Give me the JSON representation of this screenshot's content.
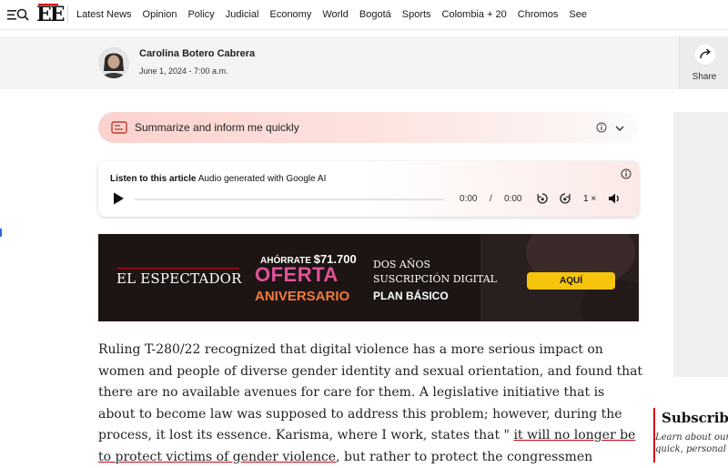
{
  "nav": {
    "logo": "EE",
    "links": [
      "Latest News",
      "Opinion",
      "Policy",
      "Judicial",
      "Economy",
      "World",
      "Bogotá",
      "Sports",
      "Colombia + 20",
      "Chromos",
      "See"
    ]
  },
  "author": {
    "name": "Carolina Botero Cabrera",
    "date": "June 1, 2024 - 7:00 a.m.",
    "share_label": "Share"
  },
  "summarize": {
    "label": "Summarize and inform me quickly"
  },
  "audio": {
    "title": "Listen to this article",
    "subtitle": "Audio generated with Google AI",
    "current_time": "0:00",
    "separator": "/",
    "total_time": "0:00",
    "speed": "1 ×"
  },
  "ad": {
    "brand": "EL ESPECTADOR",
    "save_prefix": "AHÓRRATE",
    "save_amount": "$71.700",
    "offer_line1": "OFERTA",
    "offer_line2": "ANIVERSARIO",
    "right_line1": "DOS AÑOS",
    "right_line2": "SUSCRIPCIÓN DIGITAL",
    "right_line3": "PLAN BÁSICO",
    "cta": "AQUÍ"
  },
  "article": {
    "text_before_quote": "Ruling T-280/22 recognized that digital violence has a more serious impact on women and people of diverse gender identity and sexual orientation, and found that there are no available avenues for care for them. A legislative initiative that is about to become law was supposed to address this problem; however, during the process, it lost its essence. Karisma, where I work, states that \" ",
    "quote": "it will no longer be to protect victims of gender violence",
    "text_after_quote": ", but rather to protect the congressmen"
  },
  "subscribe": {
    "title": "Subscribe",
    "desc_line1": "Learn about our",
    "desc_line2": "quick, personal"
  },
  "colors": {
    "brand_red": "#d6001c",
    "cta_yellow": "#f6c40c",
    "offer_pink": "#e0539a",
    "offer_orange": "#f07a3a"
  }
}
